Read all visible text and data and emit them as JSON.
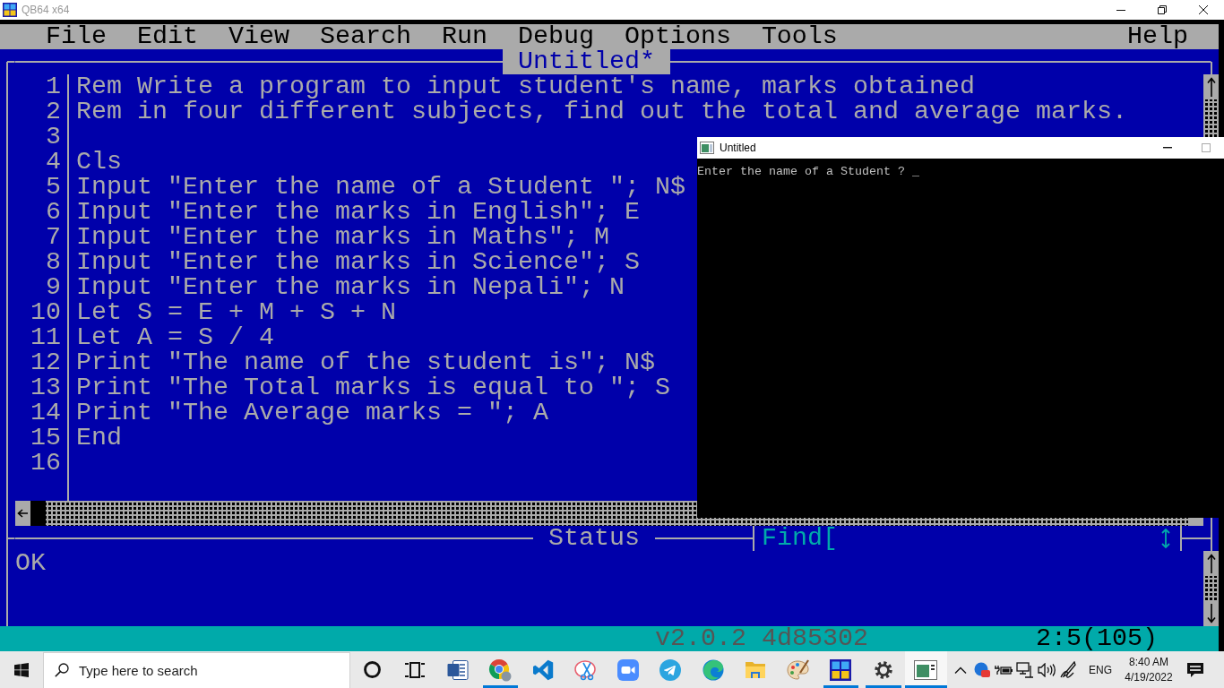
{
  "window": {
    "title": "QB64 x64"
  },
  "menu": {
    "items": [
      "File",
      "Edit",
      "View",
      "Search",
      "Run",
      "Debug",
      "Options",
      "Tools"
    ],
    "help": "Help"
  },
  "editor": {
    "title": "Untitled*",
    "lines": [
      {
        "number": "1",
        "text": "Rem Write a program to input student's name, marks obtained"
      },
      {
        "number": "2",
        "text": "Rem in four different subjects, find out the total and average marks."
      },
      {
        "number": "3"
      },
      {
        "number": "4",
        "text": "Cls"
      },
      {
        "number": "5",
        "text": "Input \"Enter the name of a Student \"; N$"
      },
      {
        "number": "6",
        "text": "Input \"Enter the marks in English\"; E"
      },
      {
        "number": "7",
        "text": "Input \"Enter the marks in Maths\"; M"
      },
      {
        "number": "8",
        "text": "Input \"Enter the marks in Science\"; S"
      },
      {
        "number": "9",
        "text": "Input \"Enter the marks in Nepali\"; N"
      },
      {
        "number": "10",
        "text": "Let S = E + M + S + N"
      },
      {
        "number": "11",
        "text": "Let A = S / 4"
      },
      {
        "number": "12",
        "text": "Print \"The name of the student is\"; N$"
      },
      {
        "number": "13",
        "text": "Print \"The Total marks is equal to \"; S"
      },
      {
        "number": "14",
        "text": "Print \"The Average marks = \"; A"
      },
      {
        "number": "15",
        "text": "End"
      },
      {
        "number": "16"
      }
    ]
  },
  "status_panel": {
    "title": "Status",
    "find_label": "Find[",
    "message": "OK"
  },
  "status_bar": {
    "version": "v2.0.2 4d85302",
    "position": "2:5(105)"
  },
  "output_window": {
    "title": "Untitled",
    "lines": [
      "Enter the name of a Student ? _"
    ]
  },
  "taskbar": {
    "search_placeholder": "Type here to search",
    "apps": [
      {
        "kind": "ring",
        "running": false,
        "selected": false
      },
      {
        "kind": "task-view",
        "running": false,
        "selected": false
      },
      {
        "kind": "document",
        "running": false,
        "selected": false
      },
      {
        "kind": "tricolor-circle",
        "running": true,
        "selected": false
      },
      {
        "kind": "ribbon",
        "running": false,
        "selected": false
      },
      {
        "kind": "scissors",
        "running": false,
        "selected": false
      },
      {
        "kind": "video-camera",
        "running": false,
        "selected": false
      },
      {
        "kind": "paper-plane",
        "running": false,
        "selected": false
      },
      {
        "kind": "wave-circle",
        "running": false,
        "selected": false
      },
      {
        "kind": "folder",
        "running": false,
        "selected": false
      },
      {
        "kind": "palette",
        "running": false,
        "selected": false
      },
      {
        "kind": "tile-logo",
        "running": true,
        "selected": false
      },
      {
        "kind": "gear",
        "running": true,
        "selected": false
      },
      {
        "kind": "window",
        "running": true,
        "selected": true
      }
    ],
    "language": "ENG",
    "time": "8:40 AM",
    "date": "4/19/2022"
  }
}
